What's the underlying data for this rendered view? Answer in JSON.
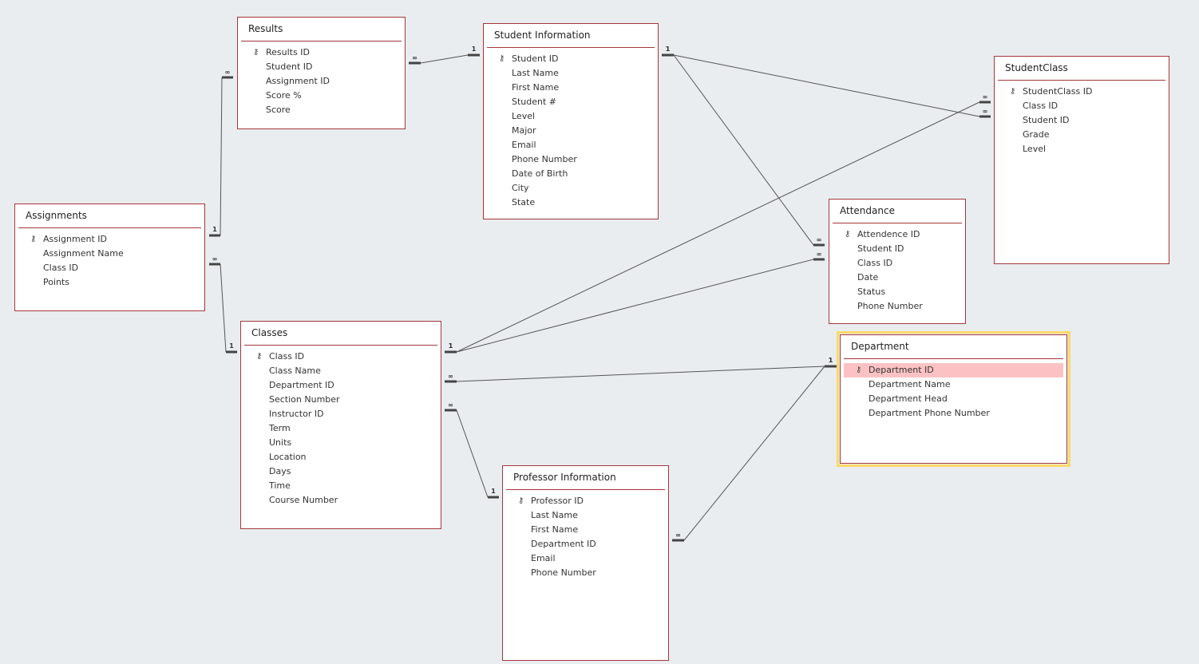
{
  "tables": [
    {
      "id": "results",
      "title": "Results",
      "fields": [
        "Results ID",
        "Student ID",
        "Assignment ID",
        "Score %",
        "Score"
      ],
      "key_field": 0
    },
    {
      "id": "student_information",
      "title": "Student Information",
      "fields": [
        "Student ID",
        "Last Name",
        "First Name",
        "Student #",
        "Level",
        "Major",
        "Email",
        "Phone Number",
        "Date of Birth",
        "City",
        "State"
      ],
      "key_field": 0
    },
    {
      "id": "studentclass",
      "title": "StudentClass",
      "fields": [
        "StudentClass ID",
        "Class ID",
        "Student ID",
        "Grade",
        "Level"
      ],
      "key_field": 0
    },
    {
      "id": "assignments",
      "title": "Assignments",
      "fields": [
        "Assignment ID",
        "Assignment Name",
        "Class ID",
        "Points"
      ],
      "key_field": 0
    },
    {
      "id": "attendance",
      "title": "Attendance",
      "fields": [
        "Attendence ID",
        "Student ID",
        "Class ID",
        "Date",
        "Status",
        "Phone Number"
      ],
      "key_field": 0
    },
    {
      "id": "classes",
      "title": "Classes",
      "fields": [
        "Class ID",
        "Class Name",
        "Department ID",
        "Section Number",
        "Instructor ID",
        "Term",
        "Units",
        "Location",
        "Days",
        "Time",
        "Course Number"
      ],
      "key_field": 0
    },
    {
      "id": "department",
      "title": "Department",
      "fields": [
        "Department ID",
        "Department Name",
        "Department Head",
        "Department Phone Number"
      ],
      "key_field": 0,
      "selected": true,
      "highlighted_field": 0
    },
    {
      "id": "professor_information",
      "title": "Professor Information",
      "fields": [
        "Professor ID",
        "Last Name",
        "First Name",
        "Department ID",
        "Email",
        "Phone Number"
      ],
      "key_field": 0
    }
  ],
  "relationships": [
    {
      "one": "student_information.Student ID",
      "many": "results.Student ID",
      "one_label": "1",
      "many_label": "∞"
    },
    {
      "one": "assignments.Assignment ID",
      "many": "results.Assignment ID",
      "one_label": "1",
      "many_label": "∞"
    },
    {
      "one": "classes.Class ID",
      "many": "assignments.Class ID",
      "one_label": "1",
      "many_label": "∞"
    },
    {
      "one": "student_information.Student ID",
      "many": "studentclass.Student ID",
      "one_label": "1",
      "many_label": "∞"
    },
    {
      "one": "student_information.Student ID",
      "many": "attendance.Student ID",
      "one_label": "1",
      "many_label": "∞"
    },
    {
      "one": "classes.Class ID",
      "many": "studentclass.Class ID",
      "one_label": "1",
      "many_label": "∞"
    },
    {
      "one": "classes.Class ID",
      "many": "attendance.Class ID",
      "one_label": "1",
      "many_label": "∞"
    },
    {
      "one": "department.Department ID",
      "many": "classes.Department ID",
      "one_label": "1",
      "many_label": "∞"
    },
    {
      "one": "professor_information.Professor ID",
      "many": "classes.Instructor ID",
      "one_label": "1",
      "many_label": "∞"
    },
    {
      "one": "department.Department ID",
      "many": "professor_information.Department ID",
      "one_label": "1",
      "many_label": "∞"
    }
  ],
  "colors": {
    "canvas": "#e9edf0",
    "table_border": "#a4373a",
    "selection": "#fbd96a",
    "highlight": "#fcc2c3",
    "line": "#555555"
  },
  "icons": {
    "primary_key": "key-icon"
  }
}
